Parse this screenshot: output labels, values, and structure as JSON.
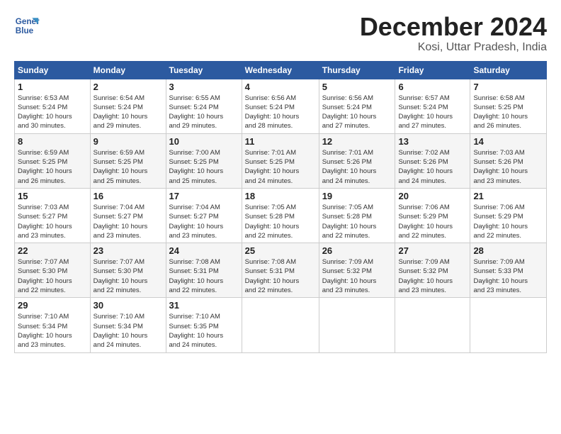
{
  "logo": {
    "line1": "General",
    "line2": "Blue"
  },
  "title": "December 2024",
  "location": "Kosi, Uttar Pradesh, India",
  "days_of_week": [
    "Sunday",
    "Monday",
    "Tuesday",
    "Wednesday",
    "Thursday",
    "Friday",
    "Saturday"
  ],
  "weeks": [
    [
      {
        "day": "1",
        "info": "Sunrise: 6:53 AM\nSunset: 5:24 PM\nDaylight: 10 hours\nand 30 minutes."
      },
      {
        "day": "2",
        "info": "Sunrise: 6:54 AM\nSunset: 5:24 PM\nDaylight: 10 hours\nand 29 minutes."
      },
      {
        "day": "3",
        "info": "Sunrise: 6:55 AM\nSunset: 5:24 PM\nDaylight: 10 hours\nand 29 minutes."
      },
      {
        "day": "4",
        "info": "Sunrise: 6:56 AM\nSunset: 5:24 PM\nDaylight: 10 hours\nand 28 minutes."
      },
      {
        "day": "5",
        "info": "Sunrise: 6:56 AM\nSunset: 5:24 PM\nDaylight: 10 hours\nand 27 minutes."
      },
      {
        "day": "6",
        "info": "Sunrise: 6:57 AM\nSunset: 5:24 PM\nDaylight: 10 hours\nand 27 minutes."
      },
      {
        "day": "7",
        "info": "Sunrise: 6:58 AM\nSunset: 5:25 PM\nDaylight: 10 hours\nand 26 minutes."
      }
    ],
    [
      {
        "day": "8",
        "info": "Sunrise: 6:59 AM\nSunset: 5:25 PM\nDaylight: 10 hours\nand 26 minutes."
      },
      {
        "day": "9",
        "info": "Sunrise: 6:59 AM\nSunset: 5:25 PM\nDaylight: 10 hours\nand 25 minutes."
      },
      {
        "day": "10",
        "info": "Sunrise: 7:00 AM\nSunset: 5:25 PM\nDaylight: 10 hours\nand 25 minutes."
      },
      {
        "day": "11",
        "info": "Sunrise: 7:01 AM\nSunset: 5:25 PM\nDaylight: 10 hours\nand 24 minutes."
      },
      {
        "day": "12",
        "info": "Sunrise: 7:01 AM\nSunset: 5:26 PM\nDaylight: 10 hours\nand 24 minutes."
      },
      {
        "day": "13",
        "info": "Sunrise: 7:02 AM\nSunset: 5:26 PM\nDaylight: 10 hours\nand 24 minutes."
      },
      {
        "day": "14",
        "info": "Sunrise: 7:03 AM\nSunset: 5:26 PM\nDaylight: 10 hours\nand 23 minutes."
      }
    ],
    [
      {
        "day": "15",
        "info": "Sunrise: 7:03 AM\nSunset: 5:27 PM\nDaylight: 10 hours\nand 23 minutes."
      },
      {
        "day": "16",
        "info": "Sunrise: 7:04 AM\nSunset: 5:27 PM\nDaylight: 10 hours\nand 23 minutes."
      },
      {
        "day": "17",
        "info": "Sunrise: 7:04 AM\nSunset: 5:27 PM\nDaylight: 10 hours\nand 23 minutes."
      },
      {
        "day": "18",
        "info": "Sunrise: 7:05 AM\nSunset: 5:28 PM\nDaylight: 10 hours\nand 22 minutes."
      },
      {
        "day": "19",
        "info": "Sunrise: 7:05 AM\nSunset: 5:28 PM\nDaylight: 10 hours\nand 22 minutes."
      },
      {
        "day": "20",
        "info": "Sunrise: 7:06 AM\nSunset: 5:29 PM\nDaylight: 10 hours\nand 22 minutes."
      },
      {
        "day": "21",
        "info": "Sunrise: 7:06 AM\nSunset: 5:29 PM\nDaylight: 10 hours\nand 22 minutes."
      }
    ],
    [
      {
        "day": "22",
        "info": "Sunrise: 7:07 AM\nSunset: 5:30 PM\nDaylight: 10 hours\nand 22 minutes."
      },
      {
        "day": "23",
        "info": "Sunrise: 7:07 AM\nSunset: 5:30 PM\nDaylight: 10 hours\nand 22 minutes."
      },
      {
        "day": "24",
        "info": "Sunrise: 7:08 AM\nSunset: 5:31 PM\nDaylight: 10 hours\nand 22 minutes."
      },
      {
        "day": "25",
        "info": "Sunrise: 7:08 AM\nSunset: 5:31 PM\nDaylight: 10 hours\nand 22 minutes."
      },
      {
        "day": "26",
        "info": "Sunrise: 7:09 AM\nSunset: 5:32 PM\nDaylight: 10 hours\nand 23 minutes."
      },
      {
        "day": "27",
        "info": "Sunrise: 7:09 AM\nSunset: 5:32 PM\nDaylight: 10 hours\nand 23 minutes."
      },
      {
        "day": "28",
        "info": "Sunrise: 7:09 AM\nSunset: 5:33 PM\nDaylight: 10 hours\nand 23 minutes."
      }
    ],
    [
      {
        "day": "29",
        "info": "Sunrise: 7:10 AM\nSunset: 5:34 PM\nDaylight: 10 hours\nand 23 minutes."
      },
      {
        "day": "30",
        "info": "Sunrise: 7:10 AM\nSunset: 5:34 PM\nDaylight: 10 hours\nand 24 minutes."
      },
      {
        "day": "31",
        "info": "Sunrise: 7:10 AM\nSunset: 5:35 PM\nDaylight: 10 hours\nand 24 minutes."
      },
      {
        "day": "",
        "info": ""
      },
      {
        "day": "",
        "info": ""
      },
      {
        "day": "",
        "info": ""
      },
      {
        "day": "",
        "info": ""
      }
    ]
  ]
}
